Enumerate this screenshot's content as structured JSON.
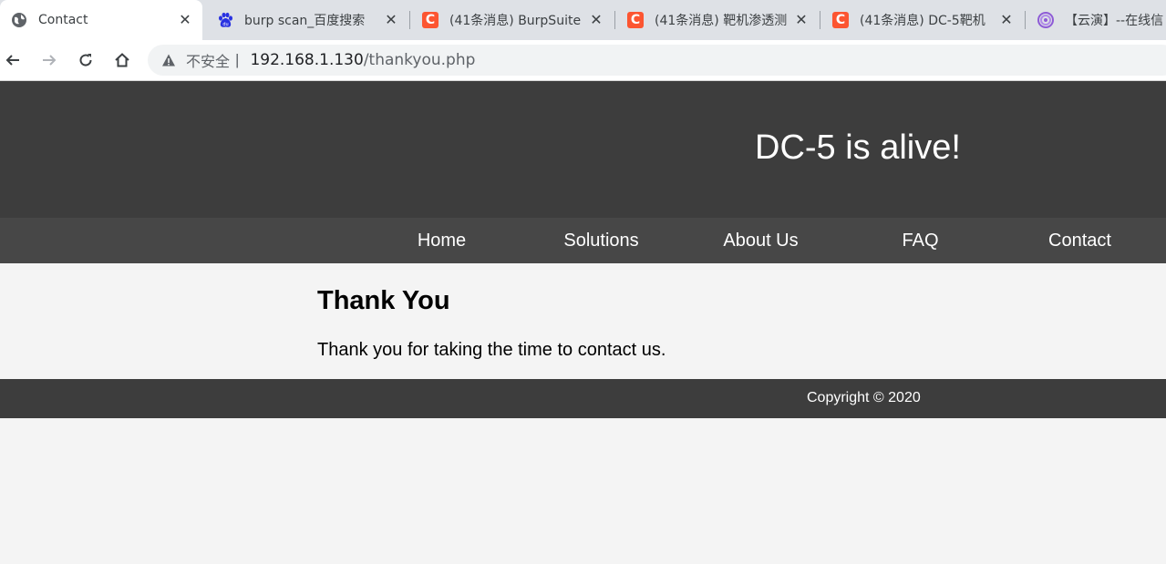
{
  "browser": {
    "tabs": [
      {
        "title": "Contact",
        "icon": "globe-icon",
        "close": "✕",
        "active": true
      },
      {
        "title": "burp scan_百度搜索",
        "icon": "baidu-icon",
        "close": "✕"
      },
      {
        "title": "(41条消息) BurpSuite",
        "icon": "csdn-icon",
        "close": "✕"
      },
      {
        "title": "(41条消息) 靶机渗透测",
        "icon": "csdn-icon",
        "close": "✕"
      },
      {
        "title": "(41条消息) DC-5靶机",
        "icon": "csdn-icon",
        "close": "✕"
      },
      {
        "title": "【云演】--在线信",
        "icon": "spiral-icon"
      }
    ],
    "csdn_letter": "C",
    "address": {
      "security_label": "不安全",
      "separator": "|",
      "host": "192.168.1.130",
      "path": "/thankyou.php"
    }
  },
  "site": {
    "title": "DC-5 is alive!",
    "nav": [
      "Home",
      "Solutions",
      "About Us",
      "FAQ",
      "Contact"
    ],
    "heading": "Thank You",
    "message": "Thank you for taking the time to contact us.",
    "footer": "Copyright © 2020"
  },
  "colors": {
    "header_bg": "#3d3d3d",
    "nav_bg": "#474747",
    "page_bg": "#f4f4f4",
    "csdn_red": "#fc5531"
  }
}
